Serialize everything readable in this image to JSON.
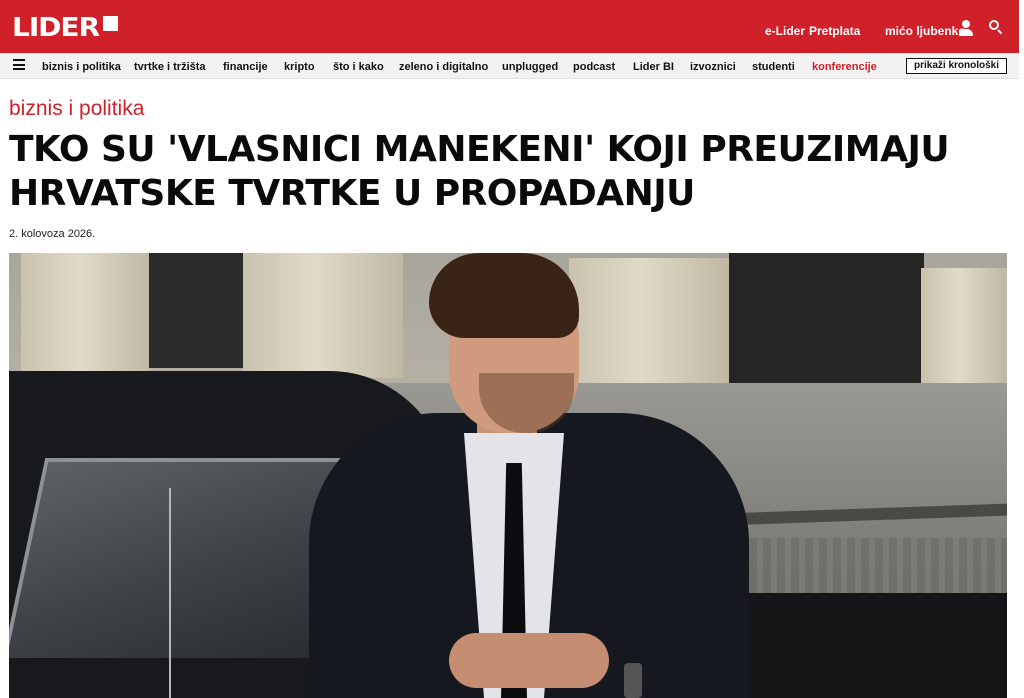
{
  "header": {
    "logo": "LIDER",
    "links": {
      "elider": "e-Lider",
      "pretplata": "Pretplata",
      "user": "mićo ljubenko"
    },
    "icons": [
      "user-icon",
      "search-icon"
    ],
    "colors": {
      "brand": "#d0202a"
    }
  },
  "nav": {
    "items": [
      "biznis i politika",
      "tvrtke i tržišta",
      "financije",
      "kripto",
      "što i kako",
      "zeleno i digitalno",
      "unplugged",
      "podcast",
      "Lider BI",
      "izvoznici",
      "studenti",
      "konferencije"
    ],
    "accent_item": "konferencije",
    "chronology_button": "prikaži kronološki"
  },
  "article": {
    "category": "biznis i politika",
    "title": "TKO SU 'VLASNICI MANEKENI' KOJI PREUZIMAJU HRVATSKE TVRTKE U PROPADANJU",
    "date": "2. kolovoza 2026."
  }
}
